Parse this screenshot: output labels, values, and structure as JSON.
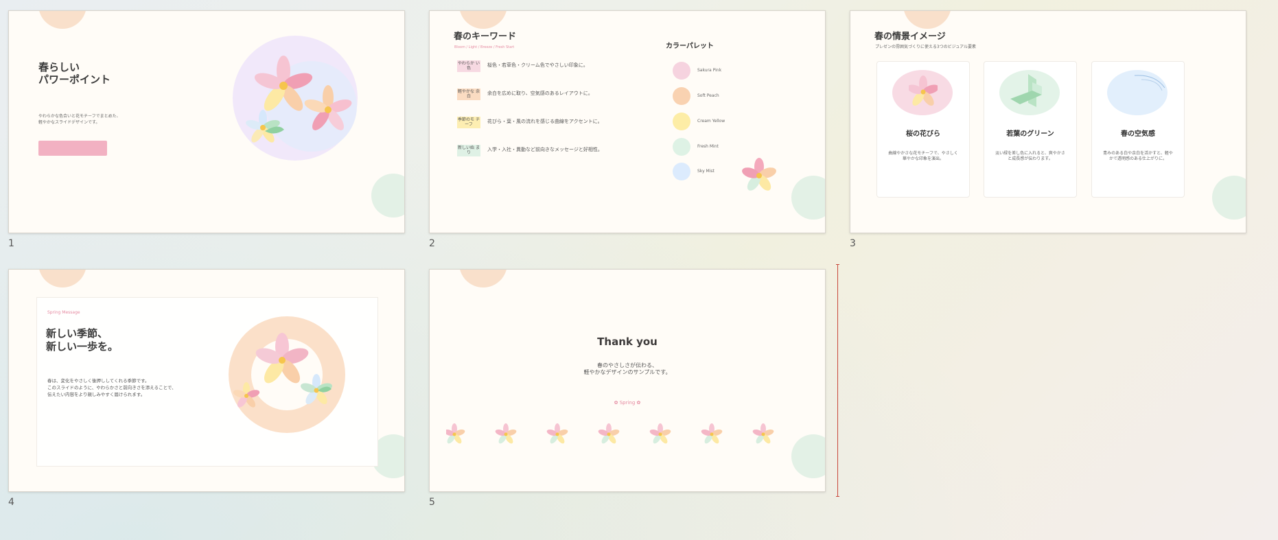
{
  "colors": {
    "sakura": "#f4b6c6",
    "peach": "#f9d2b1",
    "yellow": "#fdeaa0",
    "mint": "#c9e9d3",
    "sky": "#d6e8fb",
    "accent_pink": "#ec8fa6"
  },
  "slides": [
    {
      "number": "1",
      "title_line1": "春らしい",
      "title_line2": "パワーポイント",
      "desc_line1": "やわらかな色合いと花モチーフでまとめた、",
      "desc_line2": "軽やかなスライドデザインです。"
    },
    {
      "number": "2",
      "title": "春のキーワード",
      "subtitle": "Bloom / Light / Breeze / Fresh Start",
      "keywords": [
        {
          "tag": "やわらか い色",
          "text": "桜色・若草色・クリーム色でやさしい印象に。"
        },
        {
          "tag": "軽やかな 余白",
          "text": "余白を広めに取り、空気感のあるレイアウトに。"
        },
        {
          "tag": "季節のモ チーフ",
          "text": "花びら・葉・風の流れを感じる曲線をアクセントに。"
        },
        {
          "tag": "新しい始 まり",
          "text": "入学・入社・異動など前向きなメッセージと好相性。"
        }
      ],
      "palette_title": "カラーパレット",
      "palette": [
        {
          "name": "Sakura Pink",
          "color": "#f6d3df"
        },
        {
          "name": "Soft Peach",
          "color": "#f9d2b1"
        },
        {
          "name": "Cream Yellow",
          "color": "#fdeda6"
        },
        {
          "name": "Fresh Mint",
          "color": "#def2e5"
        },
        {
          "name": "Sky Mist",
          "color": "#dcebfd"
        }
      ]
    },
    {
      "number": "3",
      "title": "春の情景イメージ",
      "subtitle": "プレゼンの雰囲気づくりに使える3つのビジュアル要素",
      "cards": [
        {
          "heading": "桜の花びら",
          "text": "曲線やかさな花モチーフで、やさしく華やかな印象を演出。"
        },
        {
          "heading": "若葉のグリーン",
          "text": "淡い緑を差し色に入れると、爽やかさと成長感が伝わります。"
        },
        {
          "heading": "春の空気感",
          "text": "青みのある白や余白を活かすと、軽やかで透明感のある仕上がりに。"
        }
      ]
    },
    {
      "number": "4",
      "label": "Spring Message",
      "title_line1": "新しい季節、",
      "title_line2": "新しい一歩を。",
      "body_line1": "春は、変化をやさしく後押ししてくれる季節です。",
      "body_line2": "このスライドのように、やわらかさと前向きさを添えることで、",
      "body_line3": "伝えたい内容をより親しみやすく届けられます。"
    },
    {
      "number": "5",
      "title": "Thank you",
      "line1": "春のやさしさが伝わる、",
      "line2": "軽やかなデザインのサンプルです。",
      "badge": "✿ Spring ✿"
    }
  ]
}
